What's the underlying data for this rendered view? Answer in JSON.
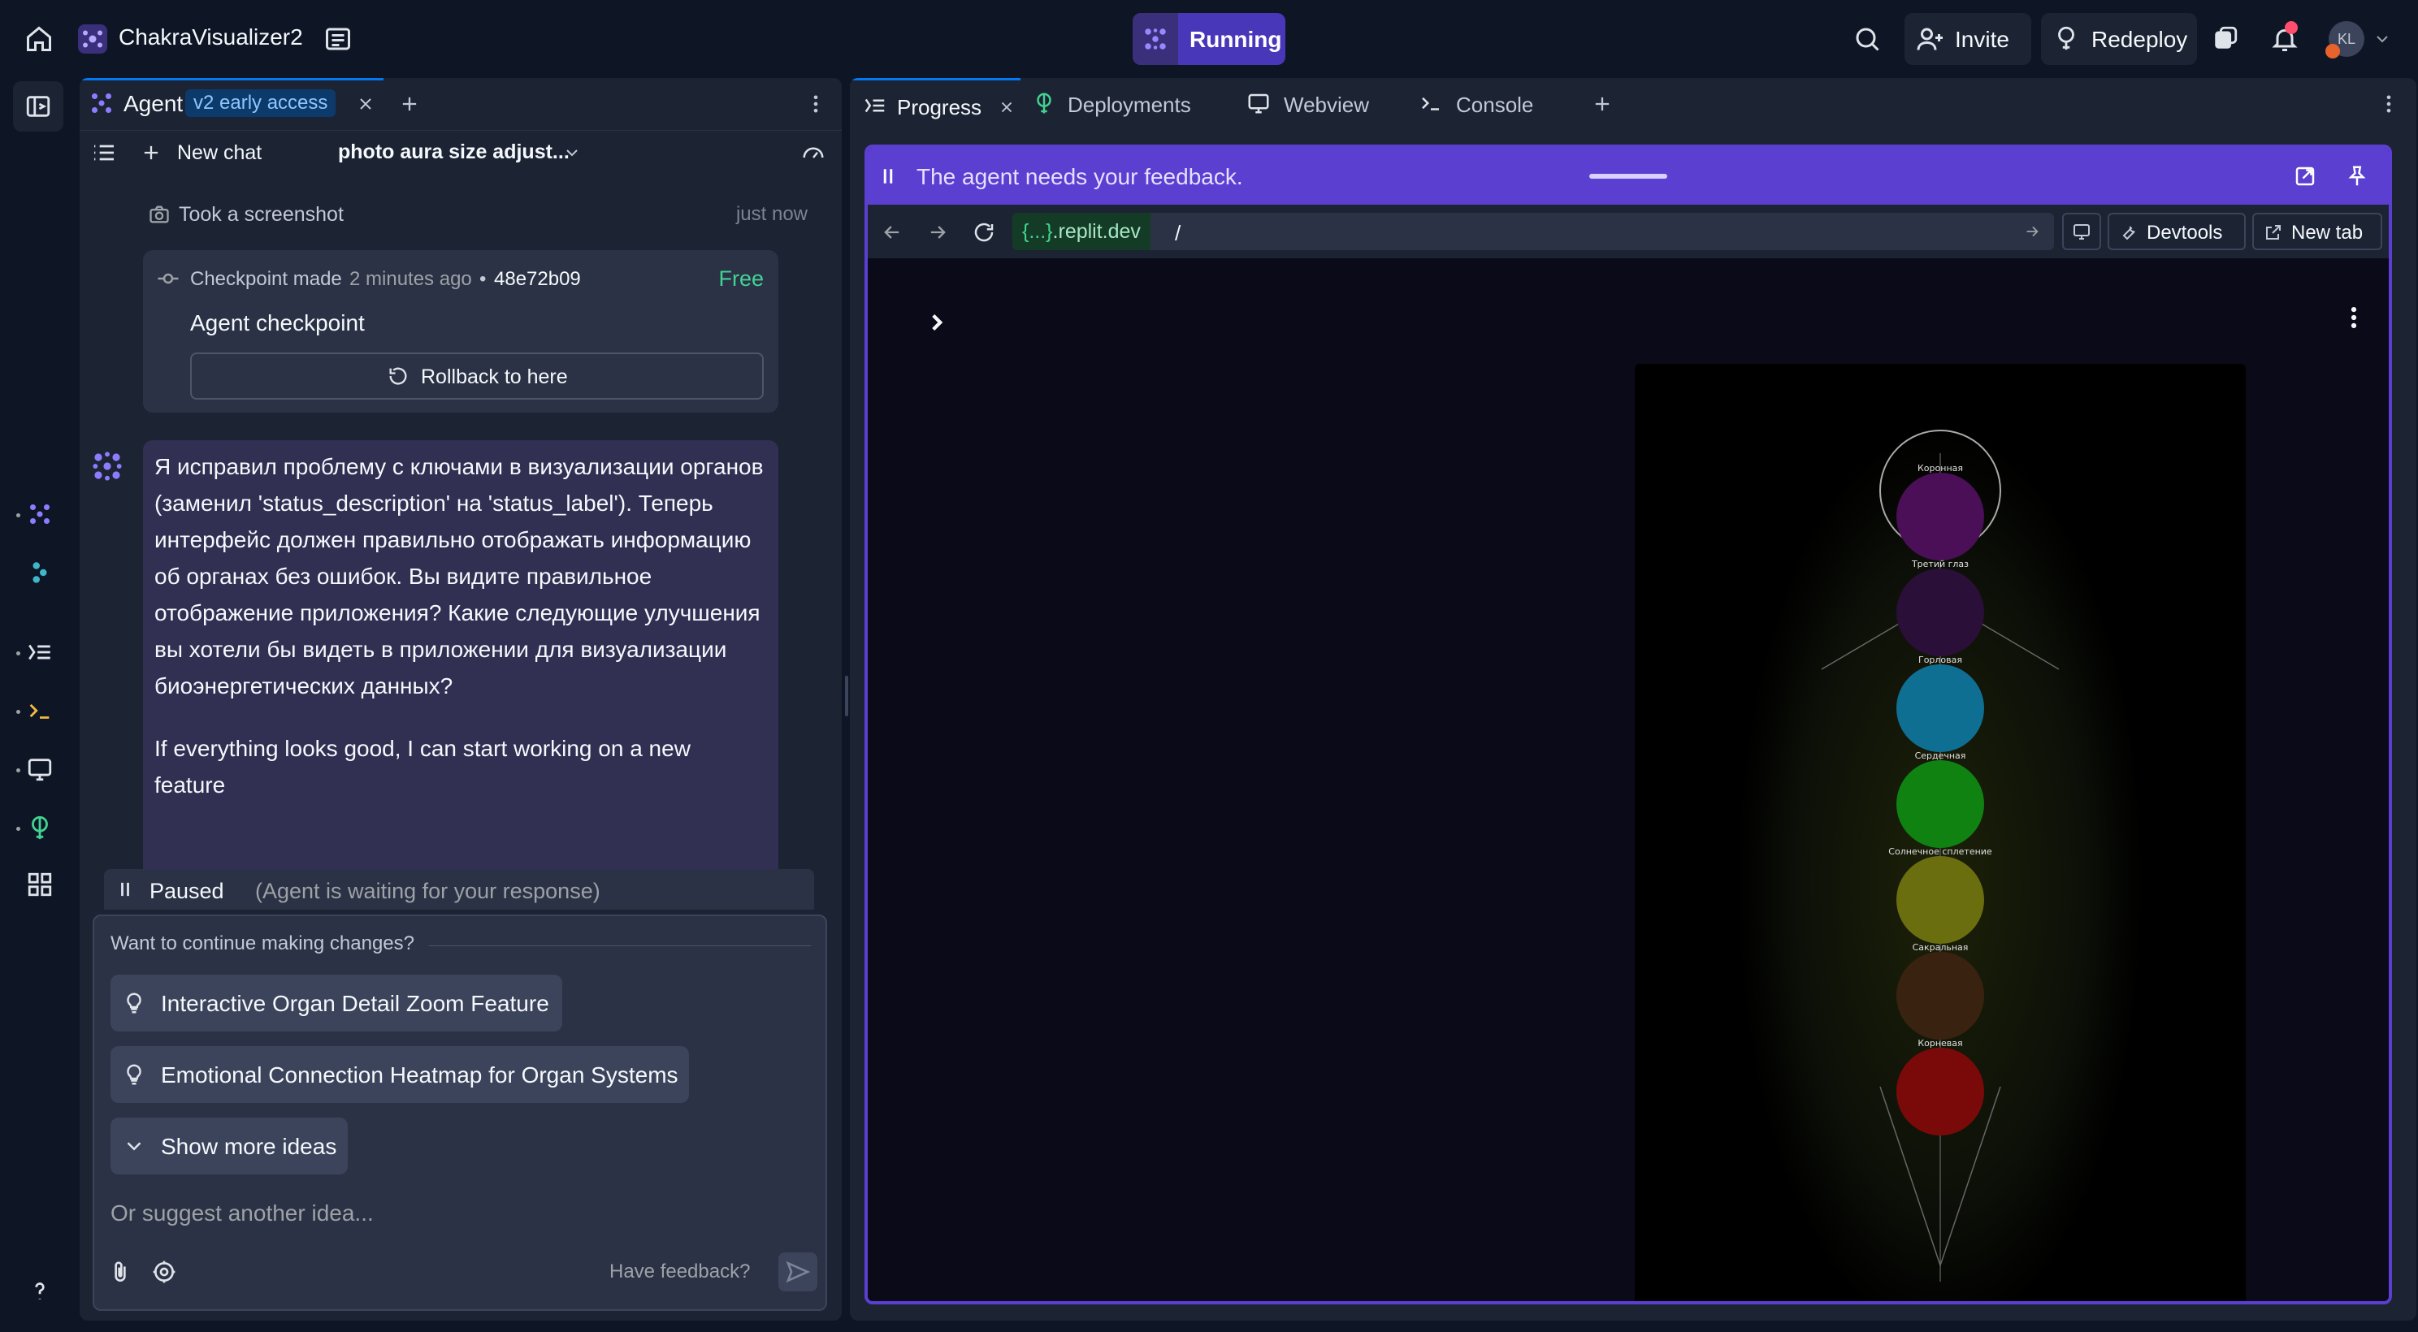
{
  "topbar": {
    "project_name": "ChakraVisualizer2",
    "run_label": "Running",
    "invite_label": "Invite",
    "redeploy_label": "Redeploy",
    "avatar_initials": "KL",
    "accent": "#6e56cf",
    "run_bg": "#5a4ae3"
  },
  "left_panel": {
    "tab_label": "Agent",
    "tab_badge": "v2 early access",
    "new_chat_label": "New chat",
    "chat_title": "photo aura size adjust...",
    "screenshot": {
      "label": "Took a screenshot",
      "time": "just now"
    },
    "checkpoint": {
      "label": "Checkpoint made",
      "ago": "2 minutes ago",
      "sep": "•",
      "hash": "48e72b09",
      "price": "Free",
      "title": "Agent checkpoint",
      "rollback_label": "Rollback to here"
    },
    "message": {
      "lines": [
        "Я исправил проблему с ключами в визуализации органов",
        "(заменил 'status_description' на 'status_label'). Теперь",
        "интерфейс должен правильно отображать информацию",
        "об органах без ошибок. Вы видите правильное",
        "отображение приложения? Какие следующие улучшения",
        "вы хотели бы видеть в приложении для визуализации",
        "биоэнергетических данных?"
      ],
      "followup_lines": [
        "If everything looks good, I can start working on a new",
        "feature"
      ]
    },
    "paused": {
      "label": "Paused",
      "detail": "(Agent is waiting for your response)"
    },
    "continue_prompt": "Want to continue making changes?",
    "ideas": [
      "Interactive Organ Detail Zoom Feature",
      "Emotional Connection Heatmap for Organ Systems"
    ],
    "show_more_label": "Show more ideas",
    "input_placeholder": "Or suggest another idea...",
    "feedback_label": "Have feedback?"
  },
  "right_panel": {
    "tabs": [
      "Progress",
      "Deployments",
      "Webview",
      "Console"
    ],
    "feedback_banner": "The agent needs your feedback.",
    "url_prefix": "{...}",
    "url_domain": ".replit.dev",
    "url_path": "/",
    "devtools_label": "Devtools",
    "newtab_label": "New tab",
    "banner_color": "#5a3fd1"
  },
  "chakra_visual": {
    "labels": [
      "Коронная",
      "Третий глаз",
      "Горловая",
      "Сердечная",
      "Солнечное сплетение",
      "Сакральная",
      "Корневая"
    ],
    "colors": [
      "#4a0f57",
      "#2a0f38",
      "#0f6f93",
      "#0f8212",
      "#6b6e0f",
      "#3a2210",
      "#7a0a0a"
    ]
  }
}
